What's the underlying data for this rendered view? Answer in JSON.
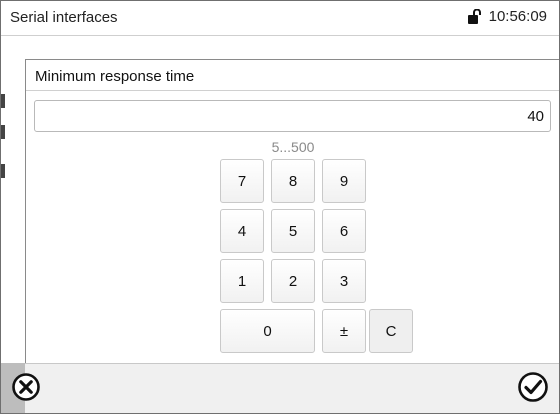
{
  "header": {
    "title": "Serial interfaces",
    "time": "10:56:09",
    "lock_icon": "lock-icon"
  },
  "dialog": {
    "title": "Minimum response time",
    "value": "40",
    "range_hint": "5...500"
  },
  "keypad": {
    "rows": [
      [
        "7",
        "8",
        "9"
      ],
      [
        "4",
        "5",
        "6"
      ],
      [
        "1",
        "2",
        "3"
      ]
    ],
    "zero": "0",
    "plus_minus": "±",
    "clear": "C"
  },
  "footer": {
    "cancel_icon": "cancel-circle-x-icon",
    "confirm_icon": "confirm-check-icon"
  }
}
